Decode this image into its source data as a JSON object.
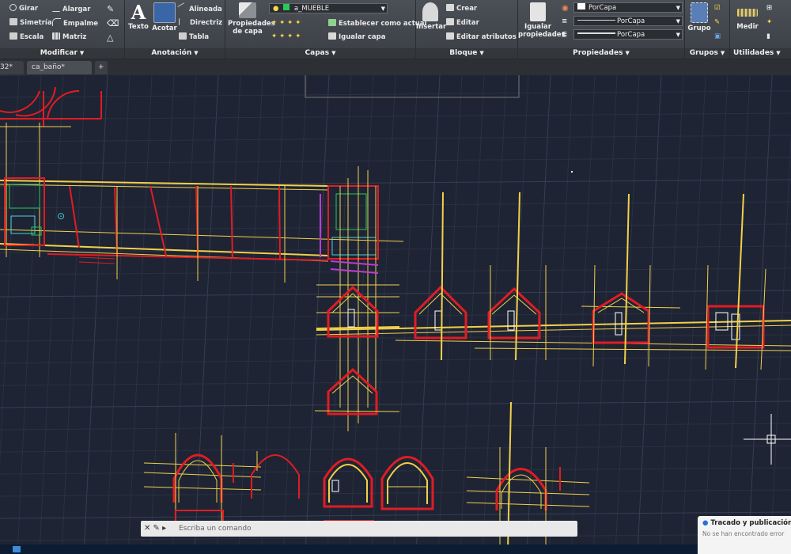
{
  "ribbon": {
    "modificar": {
      "title": "Modificar",
      "items": [
        "Girar",
        "Alargar",
        "Simetría",
        "Empalme",
        "Escala",
        "Matriz"
      ]
    },
    "anotacion": {
      "title": "Anotación",
      "texto": "Texto",
      "acotar": "Acotar",
      "items": [
        "Alineada",
        "Directriz",
        "Tabla"
      ]
    },
    "capas": {
      "title": "Capas",
      "propiedades": "Propiedades de capa",
      "layer_name": "a_MUEBLE",
      "establecer": "Establecer como actual",
      "igualar": "Igualar capa"
    },
    "bloque": {
      "title": "Bloque",
      "insertar": "Insertar",
      "items": [
        "Crear",
        "Editar",
        "Editar atributos"
      ]
    },
    "propiedades": {
      "title": "Propiedades",
      "igualar": "Igualar propiedades",
      "color_value": "PorCapa",
      "linetype_value": "PorCapa",
      "lineweight_value": "PorCapa"
    },
    "grupos": {
      "title": "Grupos",
      "grupo": "Grupo"
    },
    "utilidades": {
      "title": "Utilidades",
      "medir": "Medir"
    }
  },
  "tabs": [
    "32*",
    "ca_baño*",
    "+"
  ],
  "command_line": {
    "placeholder": "Escriba un comando"
  },
  "notification": {
    "title": "Tracado y publicación d",
    "body": "No se han encontrado error"
  },
  "colors": {
    "background": "#1e2434",
    "grid_minor": "#2a3142",
    "grid_major": "#363e52",
    "red": "#e01c24",
    "yellow": "#f2d04a",
    "green": "#28c85a",
    "magenta": "#c03ad6",
    "white": "#ffffff",
    "cyan": "#4ad2d6"
  },
  "icons": [
    "rotate-icon",
    "extend-icon",
    "mirror-icon",
    "fillet-icon",
    "scale-icon",
    "array-icon",
    "text-icon",
    "dimension-icon",
    "layer-properties-icon",
    "insert-block-icon",
    "match-properties-icon",
    "group-icon",
    "measure-icon",
    "crosshair-cursor-icon"
  ]
}
